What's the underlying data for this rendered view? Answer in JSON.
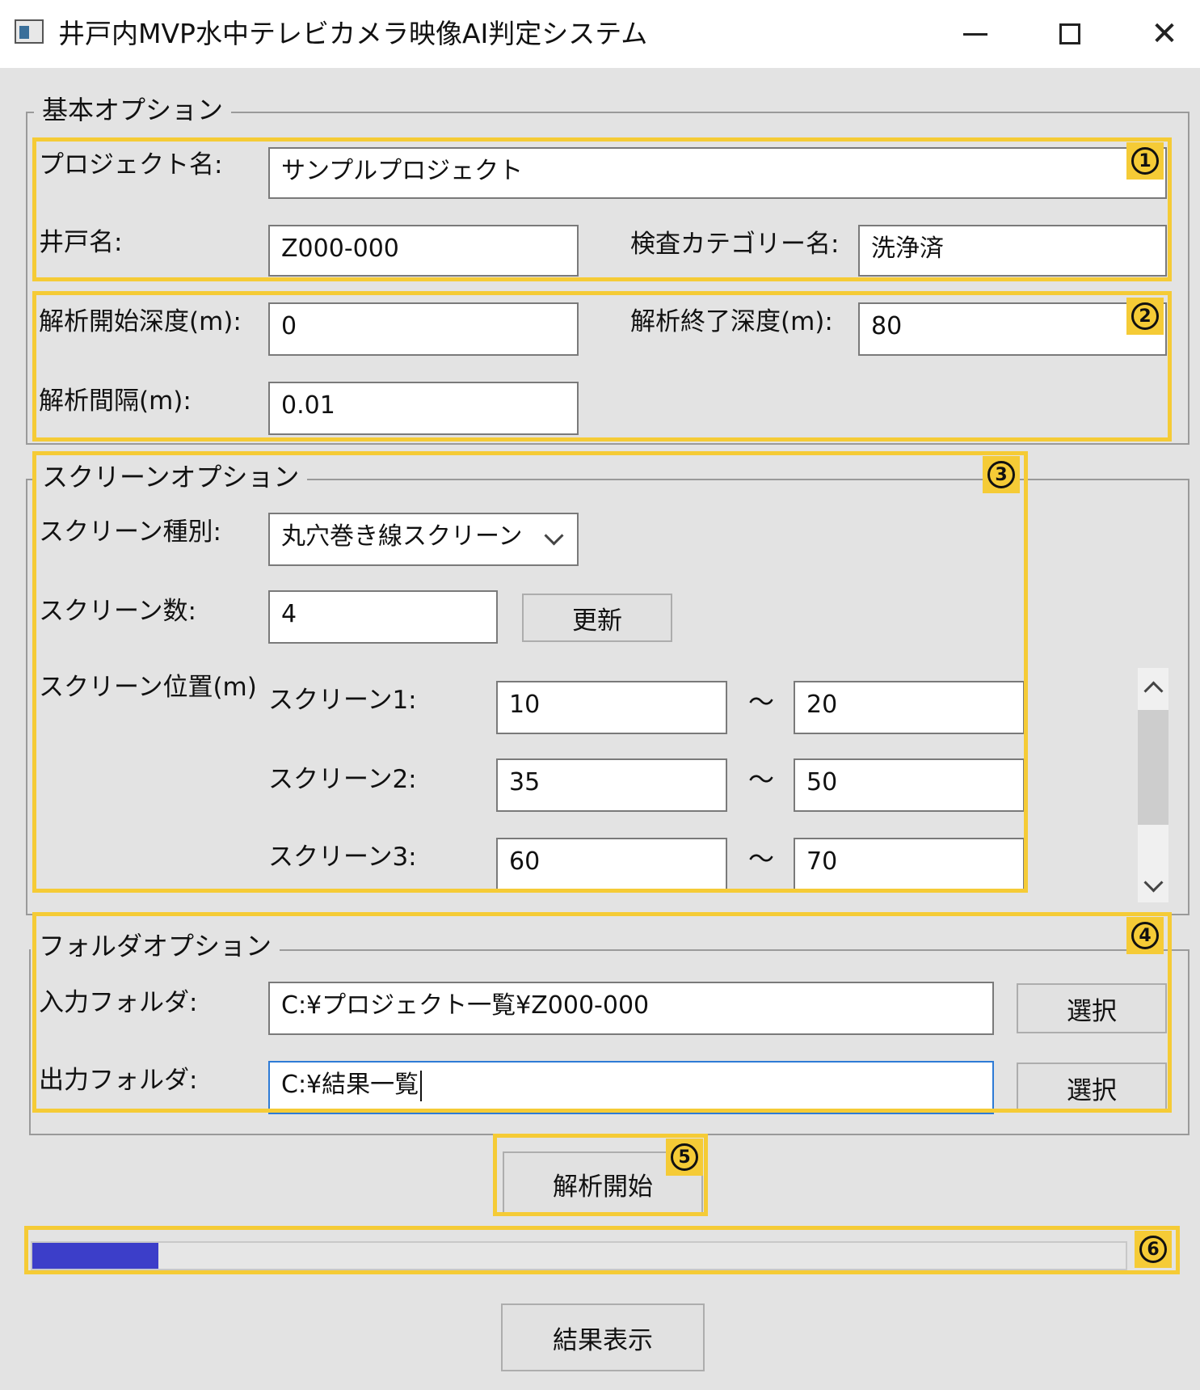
{
  "window": {
    "title": "井戸内MVP水中テレビカメラ映像AI判定システム",
    "minimize_symbol": "",
    "close_symbol": "✕"
  },
  "basic_options": {
    "legend": "基本オプション",
    "project_name_label": "プロジェクト名:",
    "project_name_value": "サンプルプロジェクト",
    "well_name_label": "井戸名:",
    "well_name_value": "Z000-000",
    "category_label": "検査カテゴリー名:",
    "category_value": "洗浄済",
    "start_depth_label": "解析開始深度(m):",
    "start_depth_value": "0",
    "end_depth_label": "解析終了深度(m):",
    "end_depth_value": "80",
    "interval_label": "解析間隔(m):",
    "interval_value": "0.01"
  },
  "screen_options": {
    "legend": "スクリーンオプション",
    "type_label": "スクリーン種別:",
    "type_value": "丸穴巻き線スクリーン",
    "count_label": "スクリーン数:",
    "count_value": "4",
    "update_button": "更新",
    "position_label": "スクリーン位置(m)",
    "tilde": "～",
    "screens": [
      {
        "label": "スクリーン1:",
        "from": "10",
        "to": "20"
      },
      {
        "label": "スクリーン2:",
        "from": "35",
        "to": "50"
      },
      {
        "label": "スクリーン3:",
        "from": "60",
        "to": "70"
      }
    ]
  },
  "folder_options": {
    "legend": "フォルダオプション",
    "input_label": "入力フォルダ:",
    "input_value": "C:¥プロジェクト一覧¥Z000-000",
    "output_label": "出力フォルダ:",
    "output_value": "C:¥結果一覧",
    "select_button": "選択"
  },
  "start_button": "解析開始",
  "progress": {
    "fraction": 0.115,
    "fill_color": "#3c3ec9"
  },
  "result_button": "結果表示",
  "annotations": {
    "color": "#f5cb36",
    "badges": [
      "1",
      "2",
      "3",
      "4",
      "5",
      "6"
    ]
  }
}
